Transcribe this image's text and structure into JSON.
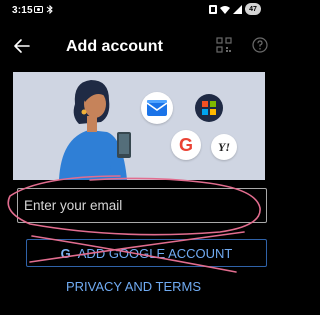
{
  "status_bar": {
    "time": "3:15",
    "left_icons": [
      "camera-icon",
      "bluetooth-icon"
    ],
    "right_icons": [
      "nfc-icon",
      "wifi-icon",
      "signal-icon"
    ],
    "battery": "47"
  },
  "app_bar": {
    "title": "Add account"
  },
  "hero": {
    "illustration": "woman-with-phone-and-app-icons",
    "app_icons": [
      "outlook-mail-icon",
      "microsoft-icon",
      "google-icon",
      "yahoo-icon"
    ]
  },
  "email_input": {
    "placeholder": "Enter your email",
    "value": ""
  },
  "google_button": {
    "icon": "G",
    "label": "ADD GOOGLE ACCOUNT"
  },
  "privacy_link": {
    "label": "PRIVACY AND TERMS"
  },
  "annotations": {
    "color": "#e26d8f"
  },
  "colors": {
    "background": "#000000",
    "accent": "#70abf2",
    "button_border": "#2f62a8",
    "hero_bg": "#cfd5e2"
  }
}
